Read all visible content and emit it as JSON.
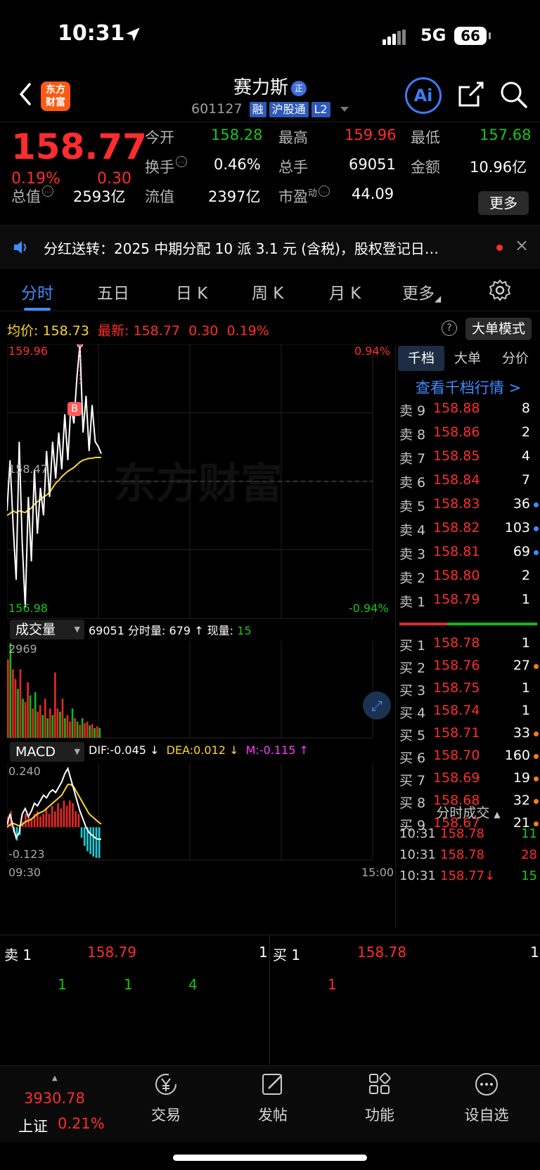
{
  "status": {
    "time": "10:31",
    "network": "5G",
    "battery": "66"
  },
  "header": {
    "logo_line1": "东方",
    "logo_line2": "财富",
    "title": "赛力斯",
    "title_badge": "正",
    "code": "601127",
    "tags": [
      "融",
      "沪股通",
      "L2"
    ],
    "ai_label": "Ai"
  },
  "quote": {
    "price": "158.77",
    "change_pct": "0.19%",
    "change": "0.30",
    "open_label": "今开",
    "open": "158.28",
    "high_label": "最高",
    "high": "159.96",
    "low_label": "最低",
    "low": "157.68",
    "turnover_label": "换手",
    "turnover": "0.46%",
    "volume_label": "总手",
    "volume": "69051",
    "amount_label": "金额",
    "amount": "10.96亿",
    "mktcap_label": "总值",
    "mktcap": "2593亿",
    "float_label": "流值",
    "float": "2397亿",
    "pe_label": "市盈",
    "pe_sup": "动",
    "pe": "44.09",
    "more_label": "更多"
  },
  "notice": {
    "text": "分红送转：2025 中期分配 10 派 3.1 元 (含税)，股权登记日…",
    "close": "×"
  },
  "tabs": [
    {
      "label": "分时",
      "active": true
    },
    {
      "label": "五日"
    },
    {
      "label": "日 K"
    },
    {
      "label": "周 K"
    },
    {
      "label": "月 K"
    },
    {
      "label": "更多"
    }
  ],
  "avg_row": {
    "avg_label": "均价:",
    "avg_value": "158.73",
    "latest_label": "最新:",
    "latest_value": "158.77",
    "latest_change": "0.30",
    "latest_pct": "0.19%",
    "mode_label": "大单模式",
    "help": "?"
  },
  "chart_data": [
    {
      "type": "line",
      "title": "",
      "ylim": [
        156.98,
        159.96
      ],
      "y_labels": {
        "top": "159.96",
        "bottom": "156.98",
        "mid": "158.47"
      },
      "pct_labels": {
        "top": "0.94%",
        "bottom": "-0.94%"
      },
      "x_labels": {
        "start": "09:30",
        "end": "15:00"
      },
      "marker": "B",
      "watermark": "东方财富",
      "series": [
        {
          "name": "最新",
          "values": [
            158.15,
            158.7,
            158.0,
            157.4,
            158.9,
            157.8,
            157.1,
            158.3,
            157.6,
            158.6,
            157.9,
            158.4,
            158.1,
            158.8,
            158.3,
            158.9,
            158.5,
            159.0,
            158.6,
            159.2,
            158.7,
            159.3,
            159.1,
            159.6,
            159.96,
            159.0,
            159.4,
            158.8,
            159.3,
            158.9,
            158.85,
            158.77
          ]
        },
        {
          "name": "均价",
          "values": [
            158.1,
            158.12,
            158.15,
            158.13,
            158.15,
            158.14,
            158.13,
            158.16,
            158.18,
            158.22,
            158.25,
            158.27,
            158.3,
            158.32,
            158.35,
            158.4,
            158.45,
            158.48,
            158.52,
            158.55,
            158.58,
            158.6,
            158.62,
            158.65,
            158.68,
            158.7,
            158.71,
            158.72,
            158.72,
            158.73,
            158.73,
            158.73
          ]
        }
      ]
    },
    {
      "type": "bar",
      "title": "成交量",
      "summary": "69051",
      "tick_label": "分时量:",
      "tick_value": "679",
      "now_label": "现量:",
      "now_value": "15",
      "ylim": [
        0,
        2969
      ],
      "y_max_label": "2969",
      "values": [
        2400,
        2900,
        2100,
        1800,
        1500,
        2100,
        1200,
        1100,
        1700,
        1300,
        900,
        1400,
        800,
        1000,
        700,
        1200,
        600,
        900,
        700,
        2000,
        900,
        800,
        1200,
        600,
        700,
        500,
        900,
        600,
        500,
        400,
        600,
        450,
        500,
        380,
        420,
        300,
        350,
        300
      ],
      "up": [
        1,
        0,
        1,
        1,
        0,
        1,
        0,
        1,
        1,
        0,
        1,
        0,
        1,
        1,
        0,
        1,
        0,
        1,
        0,
        1,
        1,
        0,
        1,
        0,
        1,
        1,
        0,
        1,
        0,
        1,
        0,
        1,
        1,
        0,
        1,
        0,
        1,
        0
      ]
    },
    {
      "type": "bar",
      "title": "MACD",
      "dif_label": "DIF:",
      "dif": "-0.045",
      "dea_label": "DEA:",
      "dea": "0.012",
      "m_label": "M:",
      "m": "-0.115",
      "ylim": [
        -0.123,
        0.24
      ],
      "y_max_label": "0.240",
      "y_min_label": "-0.123",
      "hist": [
        0.04,
        0.06,
        -0.02,
        -0.05,
        -0.03,
        0.02,
        0.05,
        0.04,
        0.03,
        0.05,
        0.06,
        0.04,
        0.05,
        0.07,
        0.05,
        0.08,
        0.06,
        0.09,
        0.07,
        0.1,
        0.08,
        0.1,
        0.09,
        0.06,
        0.05,
        -0.04,
        -0.07,
        -0.09,
        -0.1,
        -0.11,
        -0.115,
        -0.115
      ],
      "dif_line": [
        0.01,
        0.05,
        0.0,
        -0.04,
        -0.02,
        0.05,
        0.07,
        0.04,
        0.06,
        0.09,
        0.08,
        0.1,
        0.12,
        0.11,
        0.13,
        0.14,
        0.13,
        0.15,
        0.17,
        0.2,
        0.22,
        0.18,
        0.14,
        0.1,
        0.06,
        0.03,
        0.0,
        -0.02,
        -0.03,
        -0.04,
        -0.045,
        -0.045
      ],
      "dea_line": [
        0.0,
        0.01,
        0.015,
        0.01,
        0.005,
        0.01,
        0.02,
        0.025,
        0.03,
        0.04,
        0.05,
        0.055,
        0.06,
        0.07,
        0.08,
        0.09,
        0.1,
        0.11,
        0.12,
        0.14,
        0.16,
        0.16,
        0.15,
        0.13,
        0.11,
        0.09,
        0.07,
        0.05,
        0.04,
        0.03,
        0.02,
        0.012
      ]
    }
  ],
  "orderbook": {
    "tabs": [
      "千档",
      "大单",
      "分价"
    ],
    "link": "查看千档行情 >",
    "asks": [
      {
        "label": "卖 9",
        "price": "158.88",
        "qty": "8"
      },
      {
        "label": "卖 8",
        "price": "158.86",
        "qty": "2"
      },
      {
        "label": "卖 7",
        "price": "158.85",
        "qty": "4"
      },
      {
        "label": "卖 6",
        "price": "158.84",
        "qty": "7"
      },
      {
        "label": "卖 5",
        "price": "158.83",
        "qty": "36",
        "dot": "#3f8cff"
      },
      {
        "label": "卖 4",
        "price": "158.82",
        "qty": "103",
        "dot": "#3f8cff"
      },
      {
        "label": "卖 3",
        "price": "158.81",
        "qty": "69",
        "dot": "#3f8cff"
      },
      {
        "label": "卖 2",
        "price": "158.80",
        "qty": "2"
      },
      {
        "label": "卖 1",
        "price": "158.79",
        "qty": "1"
      }
    ],
    "bids": [
      {
        "label": "买 1",
        "price": "158.78",
        "qty": "1"
      },
      {
        "label": "买 2",
        "price": "158.76",
        "qty": "27",
        "dot": "#ff7a1a"
      },
      {
        "label": "买 3",
        "price": "158.75",
        "qty": "1"
      },
      {
        "label": "买 4",
        "price": "158.74",
        "qty": "1"
      },
      {
        "label": "买 5",
        "price": "158.71",
        "qty": "33",
        "dot": "#ff7a1a"
      },
      {
        "label": "买 6",
        "price": "158.70",
        "qty": "160",
        "dot": "#ff7a1a"
      },
      {
        "label": "买 7",
        "price": "158.69",
        "qty": "19",
        "dot": "#ff7a1a"
      },
      {
        "label": "买 8",
        "price": "158.68",
        "qty": "32",
        "dot": "#ff7a1a"
      },
      {
        "label": "买 9",
        "price": "158.67",
        "qty": "21",
        "dot": "#ff7a1a"
      }
    ],
    "trades_title": "分时成交",
    "trades": [
      {
        "time": "10:31",
        "price": "158.78",
        "qty": "11",
        "qty_color": "#19c519"
      },
      {
        "time": "10:31",
        "price": "158.78",
        "qty": "28",
        "qty_color": "#ff2d2d"
      },
      {
        "time": "10:31",
        "price": "158.77↓",
        "qty": "15",
        "qty_color": "#19c519"
      }
    ]
  },
  "level": {
    "sell_label": "卖 1",
    "sell_price": "158.79",
    "sell_qty": "1",
    "buy_label": "买 1",
    "buy_price": "158.78",
    "buy_qty": "1",
    "sell_queue": [
      "1",
      "1",
      "4"
    ],
    "buy_queue": [
      "1"
    ]
  },
  "nav": {
    "index_value": "3930.78",
    "index_name": "上证",
    "index_pct": "0.21%",
    "items": [
      "交易",
      "发帖",
      "功能",
      "设自选"
    ]
  }
}
